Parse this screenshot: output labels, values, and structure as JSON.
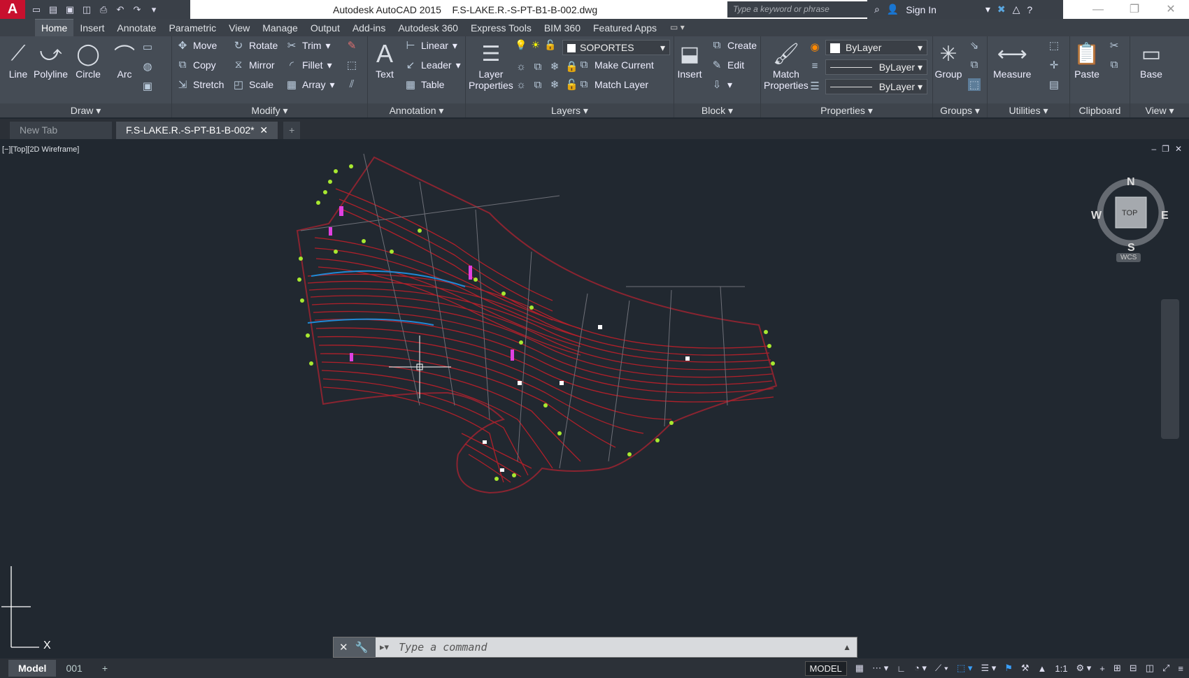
{
  "app": {
    "title": "Autodesk AutoCAD 2015",
    "filename": "F.S-LAKE.R.-S-PT-B1-B-002.dwg",
    "logo_letter": "A",
    "search_placeholder": "Type a keyword or phrase",
    "sign_in": "Sign In"
  },
  "ribbon_tabs": [
    "Home",
    "Insert",
    "Annotate",
    "Parametric",
    "View",
    "Manage",
    "Output",
    "Add-ins",
    "Autodesk 360",
    "Express Tools",
    "BIM 360",
    "Featured Apps"
  ],
  "panels": {
    "draw": {
      "title": "Draw",
      "line": "Line",
      "polyline": "Polyline",
      "circle": "Circle",
      "arc": "Arc"
    },
    "modify": {
      "title": "Modify",
      "move": "Move",
      "rotate": "Rotate",
      "trim": "Trim",
      "copy": "Copy",
      "mirror": "Mirror",
      "fillet": "Fillet",
      "stretch": "Stretch",
      "scale": "Scale",
      "array": "Array"
    },
    "annotation": {
      "title": "Annotation",
      "text": "Text",
      "linear": "Linear",
      "leader": "Leader",
      "table": "Table"
    },
    "layers": {
      "title": "Layers",
      "layer_properties_1": "Layer",
      "layer_properties_2": "Properties",
      "current_layer": "SOPORTES",
      "make_current": "Make Current",
      "match_layer": "Match Layer"
    },
    "block": {
      "title": "Block",
      "insert": "Insert",
      "create": "Create",
      "edit": "Edit"
    },
    "properties": {
      "title": "Properties",
      "match_1": "Match",
      "match_2": "Properties",
      "color": "ByLayer",
      "linetype": "ByLayer",
      "lineweight": "ByLayer"
    },
    "groups": {
      "title": "Groups",
      "group": "Group"
    },
    "utilities": {
      "title": "Utilities",
      "measure": "Measure"
    },
    "clipboard": {
      "title": "Clipboard",
      "paste": "Paste"
    },
    "view": {
      "title": "View",
      "base": "Base"
    }
  },
  "doc_tabs": [
    "New Tab",
    "F.S-LAKE.R.-S-PT-B1-B-002*"
  ],
  "viewport": {
    "label": "[−][Top][2D Wireframe]",
    "viewcube": {
      "north": "N",
      "south": "S",
      "east": "E",
      "west": "W",
      "face": "TOP",
      "ucs": "WCS"
    },
    "ucs_x": "X"
  },
  "command_line": {
    "placeholder": "Type a command"
  },
  "status": {
    "layout_tabs": [
      "Model",
      "001"
    ],
    "model_label": "MODEL",
    "scale": "1:1"
  },
  "colors": {
    "background": "#212830",
    "ribbon": "#454c55",
    "drawing_red": "#b0202a",
    "drawing_green": "#a8e830",
    "accent_blue": "#1f8ad6"
  }
}
